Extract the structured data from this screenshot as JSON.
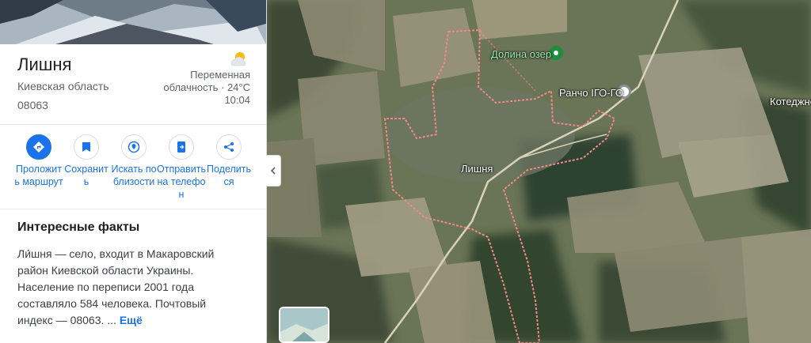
{
  "place": {
    "title": "Лишня",
    "region": "Киевская область",
    "postal_code": "08063"
  },
  "weather": {
    "line1": "Переменная",
    "line2": "облачность · 24°C",
    "time": "10:04",
    "icon": "partly-cloudy-icon"
  },
  "actions": [
    {
      "label": "Проложить маршрут",
      "icon": "directions-icon"
    },
    {
      "label": "Сохранить",
      "icon": "bookmark-icon"
    },
    {
      "label": "Искать поблизости",
      "icon": "nearby-icon"
    },
    {
      "label": "Отправить на телефон",
      "icon": "send-to-phone-icon"
    },
    {
      "label": "Поделиться",
      "icon": "share-icon"
    }
  ],
  "facts": {
    "heading": "Интересные факты",
    "text": "Ли́шня — село, входит в Макаровский район Киевской области Украины. Население по переписи 2001 года составляло 584 человека. Почтовый индекс — 08063. ...",
    "more": "Ещё"
  },
  "map": {
    "labels": {
      "village": "Лишня",
      "lake": "Долина озер",
      "ranch": "Ранчо ІГО-ГО",
      "cottage": "Котеджне"
    }
  },
  "colors": {
    "accent": "#1a73e8",
    "boundary": "#f08a84",
    "pin_green": "#1e8e3e"
  }
}
